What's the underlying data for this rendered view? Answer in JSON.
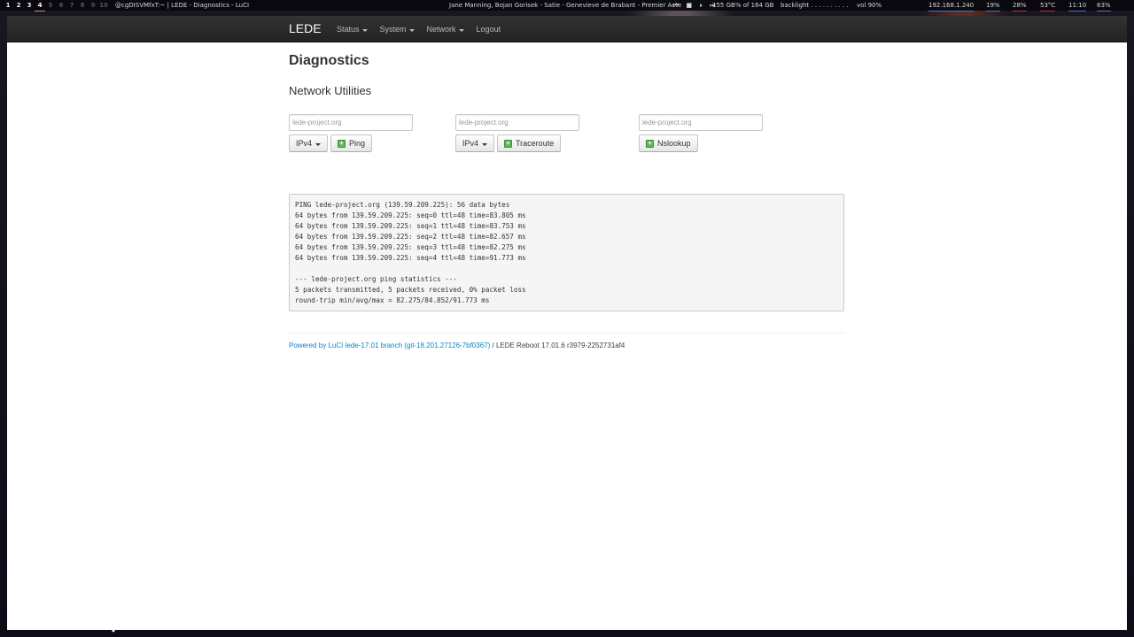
{
  "topbar": {
    "workspaces": [
      "1",
      "2",
      "3",
      "4",
      "5",
      "6",
      "7",
      "8",
      "9",
      "10"
    ],
    "window_title": "@cgDISVMfxT:~ | LEDE - Diagnostics - LuCI",
    "music": "Jane Manning, Bojan Gorisek - Satie - Genevieve de Brabant - Premier Acte",
    "controls": "⏮ ■ ⏸ ⏭",
    "disk": "155 GB% of 164 GB",
    "backlight": "backlight . . . . . . . . . .",
    "volume": "vol 90%",
    "ip": "192.168.1.240",
    "cpu": "19%",
    "mem": "28%",
    "temp": "53°C",
    "time": "11:10",
    "battery": "63%"
  },
  "navbar": {
    "brand": "LEDE",
    "menu": [
      {
        "label": "Status"
      },
      {
        "label": "System"
      },
      {
        "label": "Network"
      },
      {
        "label": "Logout"
      }
    ]
  },
  "page": {
    "title": "Diagnostics",
    "subtitle": "Network Utilities"
  },
  "tools": {
    "ping": {
      "placeholder": "lede-project.org",
      "protocol": "IPv4",
      "button": "Ping"
    },
    "traceroute": {
      "placeholder": "lede-project.org",
      "protocol": "IPv4",
      "button": "Traceroute"
    },
    "nslookup": {
      "placeholder": "lede-project.org",
      "button": "Nslookup"
    }
  },
  "output": {
    "text": "PING lede-project.org (139.59.209.225): 56 data bytes\n64 bytes from 139.59.209.225: seq=0 ttl=48 time=83.805 ms\n64 bytes from 139.59.209.225: seq=1 ttl=48 time=83.753 ms\n64 bytes from 139.59.209.225: seq=2 ttl=48 time=82.657 ms\n64 bytes from 139.59.209.225: seq=3 ttl=48 time=82.275 ms\n64 bytes from 139.59.209.225: seq=4 ttl=48 time=91.773 ms\n\n--- lede-project.org ping statistics ---\n5 packets transmitted, 5 packets received, 0% packet loss\nround-trip min/avg/max = 82.275/84.852/91.773 ms"
  },
  "footer": {
    "link": "Powered by LuCI lede-17.01 branch (git-18.201.27126-7bf0367)",
    "separator": " / ",
    "version": "LEDE Reboot 17.01.6 r3979-2252731af4"
  }
}
